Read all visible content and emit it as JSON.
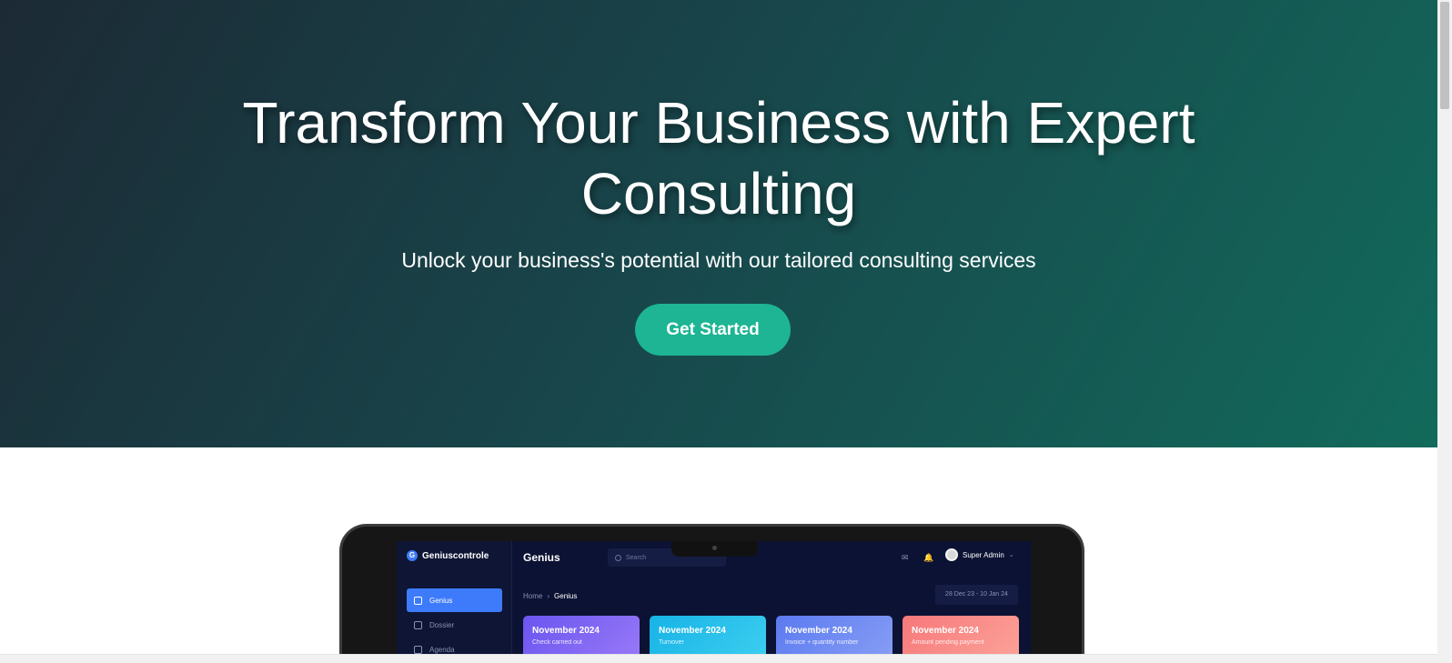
{
  "hero": {
    "title": "Transform Your Business with Expert Consulting",
    "subtitle": "Unlock your business's potential with our tailored consulting services",
    "cta_label": "Get Started"
  },
  "mockup": {
    "brand": "Geniuscontrole",
    "brand_initial": "G",
    "page_title": "Genius",
    "search_placeholder": "Search",
    "user_name": "Super Admin",
    "breadcrumb": {
      "home": "Home",
      "separator": "›",
      "current": "Genius"
    },
    "date_range": "28 Dec 23 - 10 Jan 24",
    "sidebar": [
      {
        "label": "Genius",
        "icon": "home-icon",
        "active": true
      },
      {
        "label": "Dossier",
        "icon": "folder-icon",
        "active": false
      },
      {
        "label": "Agenda",
        "icon": "calendar-icon",
        "active": false
      }
    ],
    "cards": [
      {
        "title": "November 2024",
        "subtitle": "Check carried out",
        "color": "#7b5cf5"
      },
      {
        "title": "November 2024",
        "subtitle": "Turnover",
        "color": "#1bb8e8"
      },
      {
        "title": "November 2024",
        "subtitle": "Invoice + quantity number",
        "color": "#6d86f2"
      },
      {
        "title": "November 2024",
        "subtitle": "Amount pending payment",
        "color": "#fa8a86"
      }
    ]
  },
  "colors": {
    "hero_gradient_start": "#1c2a35",
    "hero_gradient_end": "#126a5b",
    "cta_background": "#1db593",
    "app_background": "#0c1233",
    "app_accent": "#3d7bfa"
  }
}
